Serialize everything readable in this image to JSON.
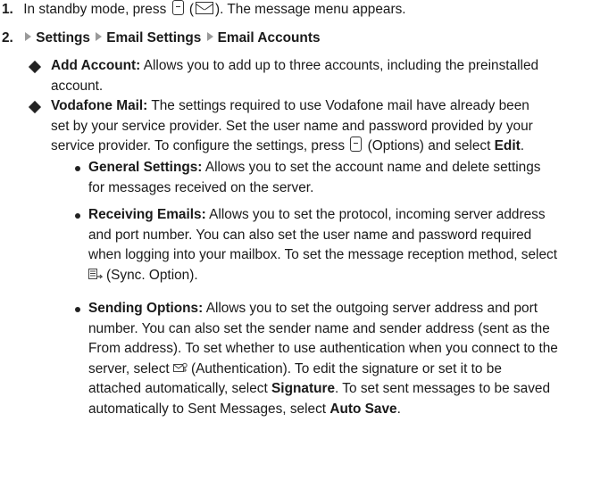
{
  "step1": {
    "number": "1.",
    "text": "In standby mode, press",
    "key_paren": "(",
    "key_paren_close": ").",
    "rest": "The message menu appears."
  },
  "step2": {
    "number": "2.",
    "path": [
      "Settings",
      "Email Settings",
      "Email Accounts"
    ]
  },
  "add_account": {
    "label": "Add Account:",
    "line1": "Allows you to add up to three accounts, including the preinstalled",
    "line2": "account."
  },
  "vodafone_mail": {
    "label": "Vodafone Mail:",
    "line1": "The settings required to use Vodafone mail have already been",
    "line2": "set by your service provider. Set the user name and password provided by your",
    "line3_pre": "service provider. To configure the settings, press",
    "line3_mid": "(Options) and select",
    "line3_bold": "Edit",
    "line3_end": "."
  },
  "general_settings": {
    "label": "General Settings:",
    "line1": "Allows you to set the account name and delete settings",
    "line2": "for messages received on the server."
  },
  "receiving_emails": {
    "label": "Receiving Emails:",
    "line1": "Allows you to set the protocol, incoming server address",
    "line2": "and port number. You can also set the user name and password required",
    "line3": "when logging into your mailbox. To set the message reception method, select",
    "line4": "(Sync. Option)."
  },
  "sending_options": {
    "label": "Sending Options:",
    "line1": "Allows you to set the outgoing server address and port",
    "line2": "number. You can also set the sender name and sender address (sent as the",
    "line3": "From address). To set whether to use authentication when you connect to the",
    "line4_pre": "server, select",
    "line4_post": "(Authentication). To edit the signature or set it to be",
    "line5_pre": "attached automatically, select",
    "line5_bold": "Signature",
    "line5_post": ". To set sent messages to be saved",
    "line6_pre": "automatically to Sent Messages, select",
    "line6_bold": "Auto Save",
    "line6_post": "."
  },
  "icons": {
    "softkey": "left-softkey-icon",
    "message": "envelope-icon",
    "sync": "sync-option-icon",
    "auth": "authentication-icon",
    "arrow": "triangle-arrow-icon"
  }
}
